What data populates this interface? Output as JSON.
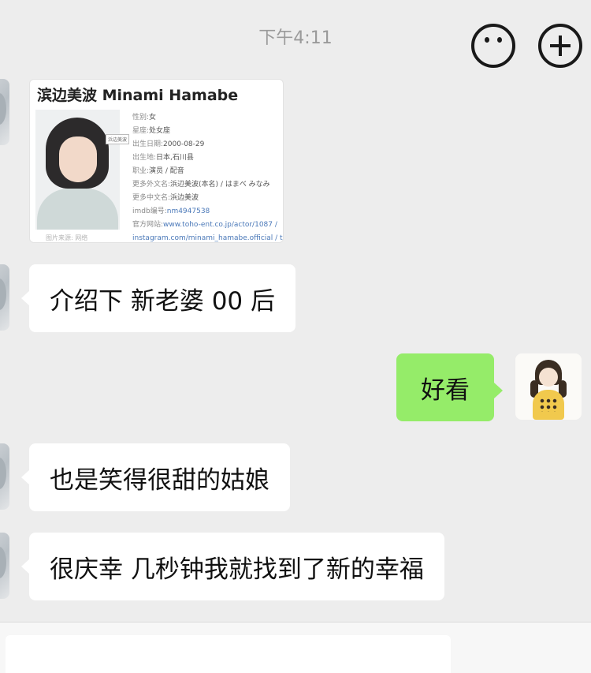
{
  "status": {
    "time": "下午4:11"
  },
  "card": {
    "title": "滨边美波 Minami Hamabe",
    "photo_tag": "浜边美波",
    "photo_caption": "图片来源: 网络",
    "rows": [
      {
        "label": "性别:",
        "value": "女"
      },
      {
        "label": "星座:",
        "value": "处女座"
      },
      {
        "label": "出生日期:",
        "value": "2000-08-29"
      },
      {
        "label": "出生地:",
        "value": "日本,石川县"
      },
      {
        "label": "职业:",
        "value": "演员 / 配音"
      },
      {
        "label": "更多外文名:",
        "value": "浜辺美波(本名) / はまべ みなみ"
      },
      {
        "label": "更多中文名:",
        "value": "浜边美波"
      },
      {
        "label": "imdb编号:",
        "value": "nm4947538"
      },
      {
        "label": "官方网站:",
        "value": "www.toho-ent.co.jp/actor/1087 /"
      },
      {
        "label": "",
        "value": "instagram.com/minami_hamabe.official / t"
      }
    ]
  },
  "messages": [
    {
      "side": "left",
      "text": "介绍下 新老婆 00 后"
    },
    {
      "side": "right",
      "text": "好看"
    },
    {
      "side": "left",
      "text": "也是笑得很甜的姑娘"
    },
    {
      "side": "left",
      "text": "很庆幸 几秒钟我就找到了新的幸福"
    }
  ]
}
